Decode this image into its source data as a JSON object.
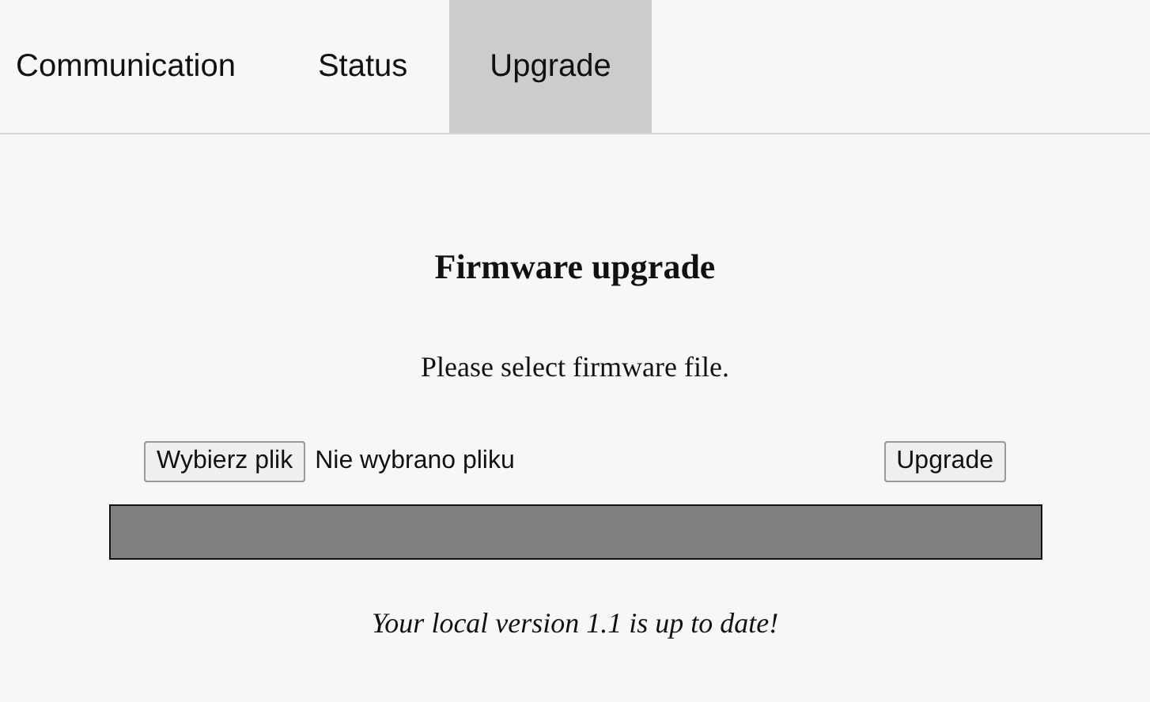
{
  "tabs": [
    {
      "label": "Communication",
      "selected": false
    },
    {
      "label": "Status",
      "selected": false
    },
    {
      "label": "Upgrade",
      "selected": true
    }
  ],
  "upgrade": {
    "title": "Firmware upgrade",
    "instruction": "Please select firmware file.",
    "file_button": "Wybierz plik",
    "file_status": "Nie wybrano pliku",
    "upgrade_button": "Upgrade",
    "progress": {
      "level": 1
    },
    "message": "Your local version 1.1 is up to date!"
  }
}
